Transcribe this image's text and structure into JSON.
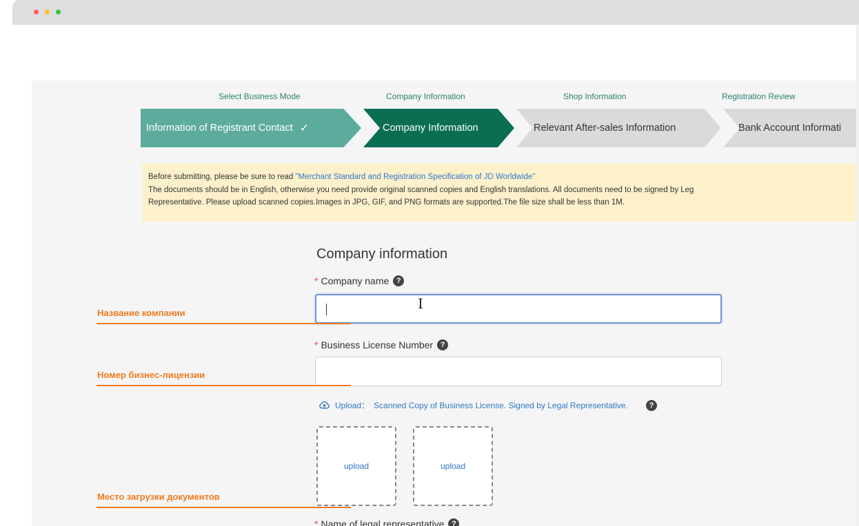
{
  "browser": {
    "dots": [
      "close",
      "minimize",
      "maximize"
    ]
  },
  "steps": {
    "titles": [
      "Select Business Mode",
      "Company Information",
      "Shop Information",
      "Registration Review"
    ],
    "chevrons": [
      {
        "label": "Information of Registrant Contact",
        "state": "completed"
      },
      {
        "label": "Company Information",
        "state": "active"
      },
      {
        "label": "Relevant After-sales Information",
        "state": "pending"
      },
      {
        "label": "Bank Account Informati",
        "state": "pending"
      }
    ],
    "check_icon": "✓"
  },
  "notice": {
    "prefix": "Before submitting, please be sure to read ",
    "link": "\"Merchant Standard and Registration Specification of JD Worldwide\"",
    "line2": "The documents should be in English, otherwise you need provide original scanned copies and English translations. All documents need to be signed by Leg",
    "line3": "Representative. Please upload scanned copies.Images in JPG, GIF, and PNG formats are supported.The file size shall be less than 1M."
  },
  "form": {
    "section_title": "Company information",
    "required_mark": "*",
    "company_name_label": "Company name",
    "company_name_value": "",
    "business_license_label": "Business License Number",
    "business_license_value": "",
    "upload_label": "Upload：",
    "upload_hint": "Scanned Copy of Business License. Signed by Legal Representative.",
    "upload_box_1": "upload",
    "upload_box_2": "upload",
    "next_field_label": "Name of legal representative",
    "help_icon": "?"
  },
  "annotations": {
    "company_name": "Название компании",
    "business_license": "Номер бизнес-лицензии",
    "upload_place": "Место загрузки документов"
  },
  "colors": {
    "completed_step": "#5cab9d",
    "active_step": "#0b6e52",
    "pending_step": "#dadada",
    "annotation": "#ef7b21",
    "link": "#2f77c5",
    "notice_bg": "#fdf1cc"
  }
}
